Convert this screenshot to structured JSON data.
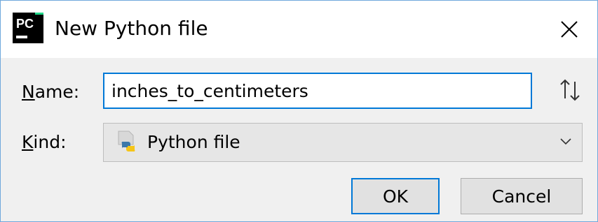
{
  "window": {
    "title": "New Python file",
    "app_icon_text": "PC",
    "close_glyph": "✕"
  },
  "form": {
    "name_label_mnemonic": "N",
    "name_label_rest": "ame:",
    "name_value": "inches_to_centimeters",
    "kind_label_mnemonic": "K",
    "kind_label_rest": "ind:",
    "kind_value": "Python file",
    "sort_icon": "sort-arrows-icon"
  },
  "buttons": {
    "ok_label": "OK",
    "cancel_label": "Cancel"
  },
  "colors": {
    "focus_border": "#0078d7",
    "dialog_background": "#f0f0f0",
    "window_border": "#6fa8dc"
  }
}
